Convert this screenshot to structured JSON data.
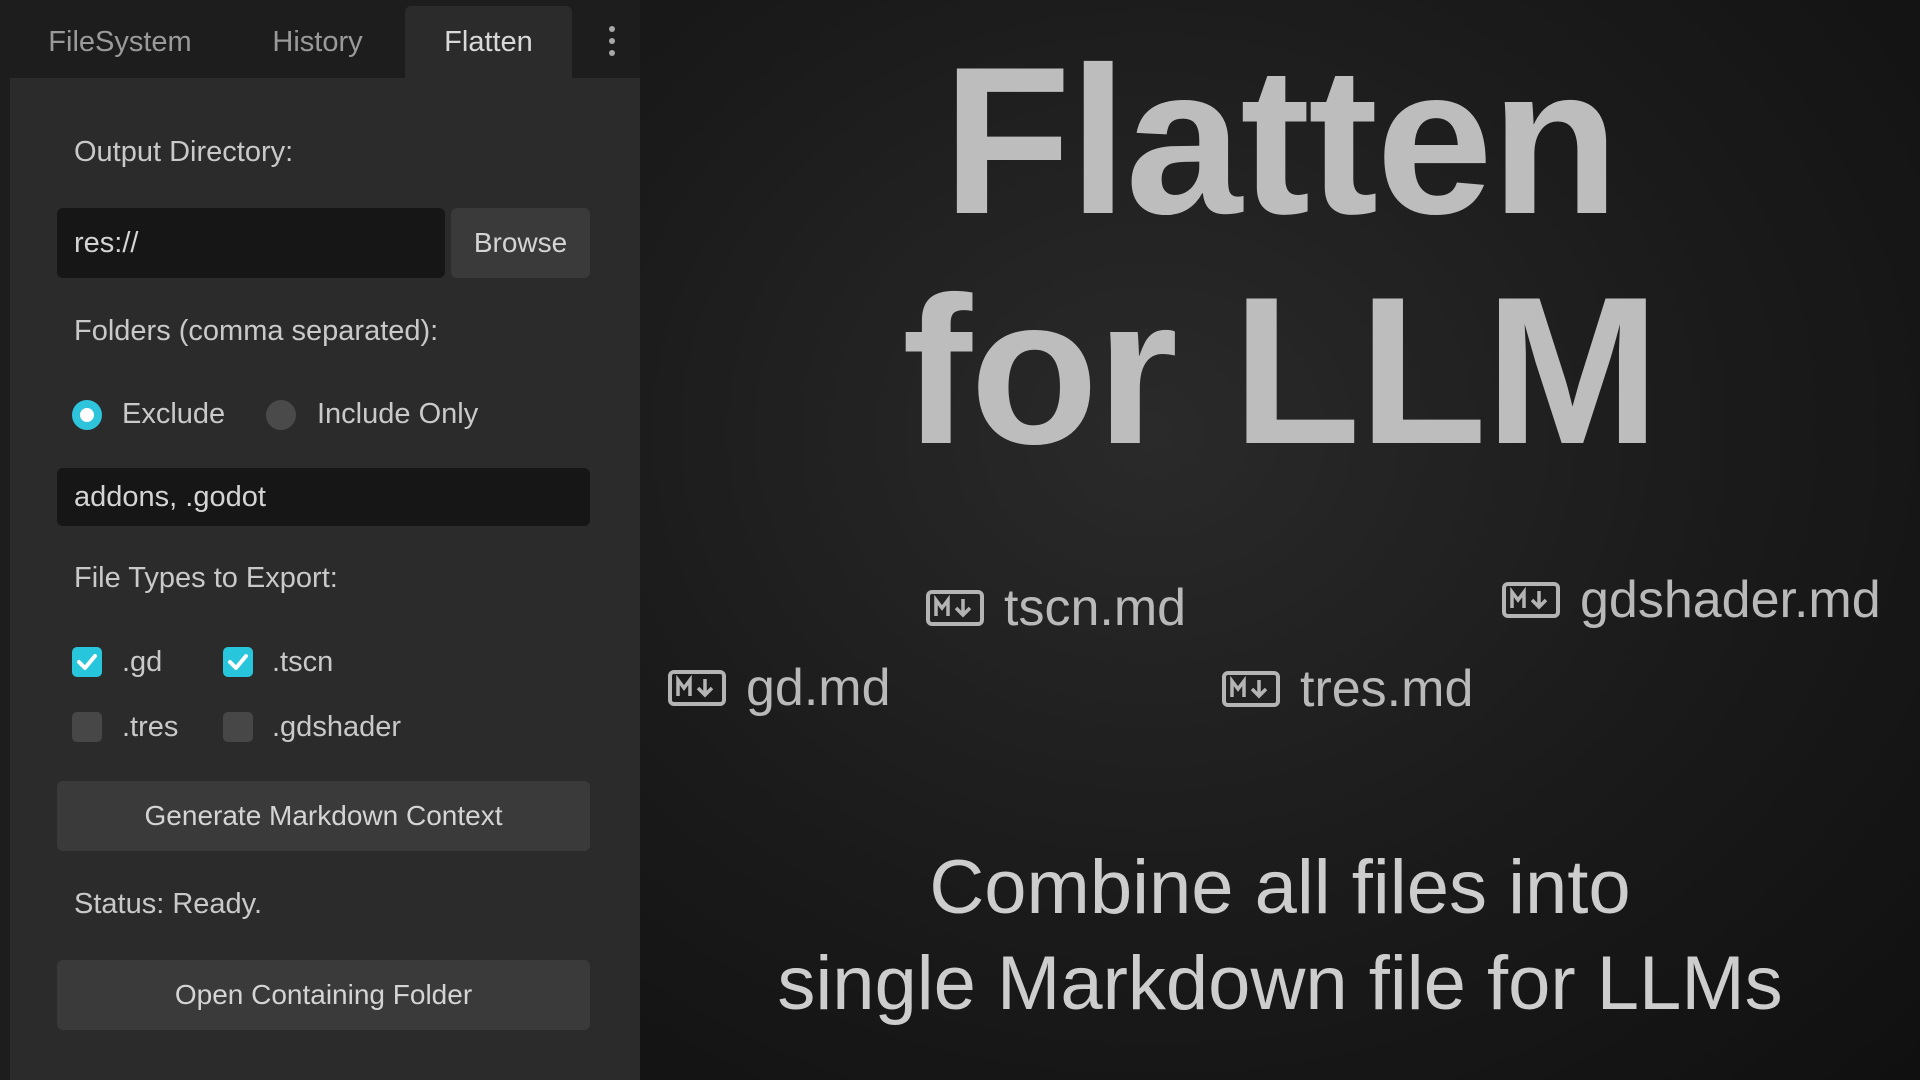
{
  "tabs": [
    {
      "label": "FileSystem",
      "active": false
    },
    {
      "label": "History",
      "active": false
    },
    {
      "label": "Flatten",
      "active": true
    }
  ],
  "menu_icon": "vertical-ellipsis-icon",
  "panel": {
    "output_directory_label": "Output Directory:",
    "output_directory_value": "res://",
    "browse_label": "Browse",
    "folders_label": "Folders (comma separated):",
    "mode_options": [
      {
        "label": "Exclude",
        "selected": true
      },
      {
        "label": "Include Only",
        "selected": false
      }
    ],
    "folders_value": "addons, .godot",
    "file_types_label": "File Types to Export:",
    "file_types": [
      {
        "label": ".gd",
        "checked": true
      },
      {
        "label": ".tscn",
        "checked": true
      },
      {
        "label": ".tres",
        "checked": false
      },
      {
        "label": ".gdshader",
        "checked": false
      }
    ],
    "generate_label": "Generate Markdown Context",
    "status_text": "Status: Ready.",
    "open_folder_label": "Open Containing Folder"
  },
  "hero": {
    "title_line1": "Flatten",
    "title_line2": "for LLM",
    "files": [
      {
        "name": "tscn.md",
        "icon": "markdown-icon"
      },
      {
        "name": "gdshader.md",
        "icon": "markdown-icon"
      },
      {
        "name": "gd.md",
        "icon": "markdown-icon"
      },
      {
        "name": "tres.md",
        "icon": "markdown-icon"
      }
    ],
    "subtitle_line1": "Combine all files into",
    "subtitle_line2": "single Markdown file for LLMs"
  },
  "colors": {
    "accent": "#2ec4dc",
    "panel_bg": "#2b2b2b",
    "dock_bg": "#1d1d1d"
  }
}
